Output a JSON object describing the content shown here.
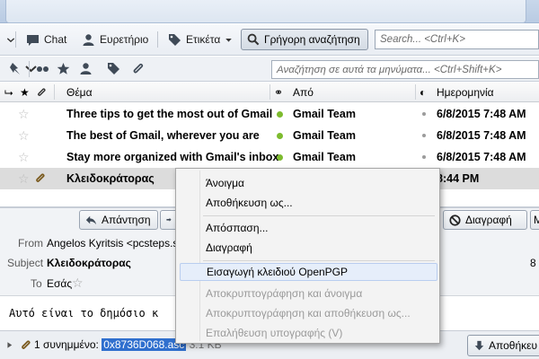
{
  "toolbar": {
    "chat": "Chat",
    "directory": "Ευρετήριο",
    "tag": "Ετικέτα",
    "quick_search": "Γρήγορη αναζήτηση",
    "search_placeholder": "Search... <Ctrl+K>"
  },
  "filter": {
    "search_placeholder": "Αναζήτηση σε αυτά τα μηνύματα... <Ctrl+Shift+K>"
  },
  "columns": {
    "subject": "Θέμα",
    "from": "Από",
    "date": "Ημερομηνία"
  },
  "messages": [
    {
      "subject": "Three tips to get the most out of Gmail",
      "from": "Gmail Team",
      "date": "6/8/2015 7:48 AM"
    },
    {
      "subject": "The best of Gmail, wherever you are",
      "from": "Gmail Team",
      "date": "6/8/2015 7:48 AM"
    },
    {
      "subject": "Stay more organized with Gmail's inbox",
      "from": "Gmail Team",
      "date": "6/8/2015 7:48 AM"
    },
    {
      "subject": "Κλειδοκράτορας",
      "from": "",
      "date": "8:44 PM"
    }
  ],
  "message_view": {
    "reply": "Απάντηση",
    "delete": "Διαγραφή",
    "more": "M",
    "from_label": "From",
    "from_value": "Angelos Kyritsis <pcsteps.s",
    "subject_label": "Subject",
    "subject_value": "Κλειδοκράτορας",
    "to_label": "To",
    "to_value": "Εσάς",
    "date_fragment": "8",
    "body": "Αυτό είναι το δημόσιο κ"
  },
  "attachment": {
    "count_label": "1 συνημμένο:",
    "filename": "0x8736D068.asc",
    "size": "3.1 KB",
    "save": "Αποθήκευ"
  },
  "context_menu": {
    "items": [
      {
        "label": "Άνοιγμα",
        "disabled": false
      },
      {
        "label": "Αποθήκευση ως...",
        "disabled": false
      },
      {
        "label": "Απόσπαση...",
        "disabled": false
      },
      {
        "label": "Διαγραφή",
        "disabled": false
      },
      {
        "label": "Εισαγωγή κλειδιού OpenPGP",
        "disabled": false
      },
      {
        "label": "Αποκρυπτογράφηση και άνοιγμα",
        "disabled": true
      },
      {
        "label": "Αποκρυπτογράφηση και αποθήκευση ως...",
        "disabled": true
      },
      {
        "label": "Επαλήθευση υπογραφής (V)",
        "disabled": true
      }
    ]
  },
  "colors": {
    "highlight": "#2f6fce",
    "read_dot": "#7dbb2e"
  }
}
